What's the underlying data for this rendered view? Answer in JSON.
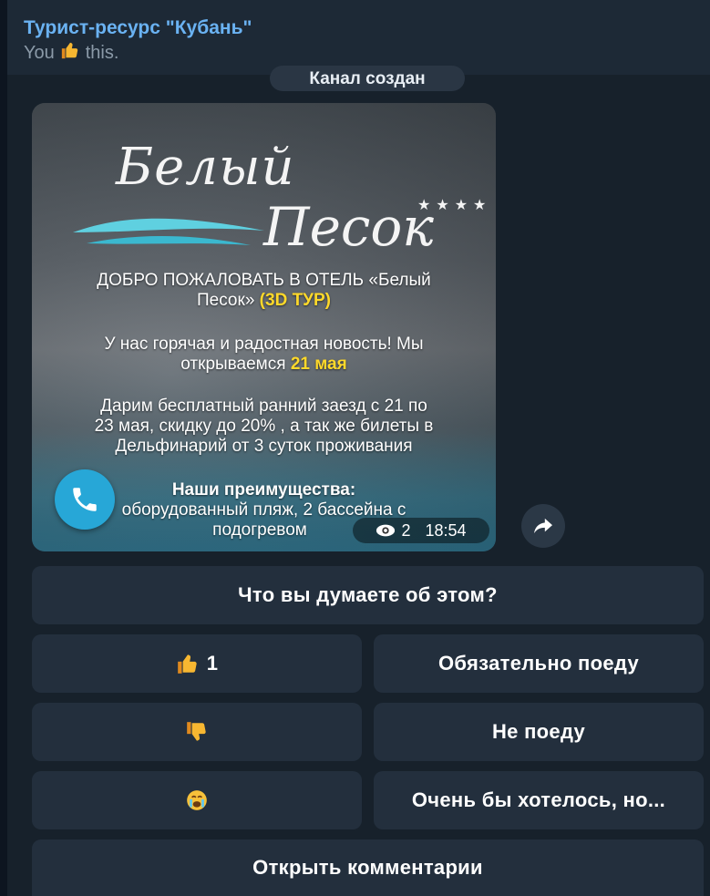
{
  "header": {
    "channel_title": "Турист-ресурс \"Кубань\"",
    "status_you": "You",
    "status_reaction_icon": "thumbs-up-icon",
    "status_suffix": "this."
  },
  "service_message": "Канал создан",
  "post": {
    "logo_word1": "Белый",
    "logo_word2": "Песок",
    "logo_stars": "★★★★",
    "line1": "ДОБРО ПОЖАЛОВАТЬ В ОТЕЛЬ «Белый",
    "line2_plain": "Песок»",
    "line2_bold": "(3D ТУР)",
    "line3": "У нас горячая и радостная новость! Мы",
    "line4_plain": "открываемся",
    "line4_bold": "21 мая",
    "line5": "Дарим бесплатный ранний заезд с 21 по",
    "line6": "23 мая, скидку до 20% , а так же билеты в",
    "line7": "Дельфинарий от 3 суток проживания",
    "line8": "Наши преимущества:",
    "line9": "оборудованный пляж, 2 бассейна с",
    "line10": "подогревом",
    "views": "2",
    "time": "18:54",
    "colors": {
      "highlight": "#ffd92a",
      "call_button": "#27a7d7"
    }
  },
  "keyboard": {
    "question": "Что вы думаете об этом?",
    "like_count": "1",
    "option_go": "Обязательно поеду",
    "option_not_go": "Не поеду",
    "option_wish": "Очень бы хотелось, но...",
    "comments": "Открыть комментарии",
    "icons": [
      "thumbs-up-icon",
      "thumbs-down-icon",
      "crying-face-icon"
    ]
  },
  "colors": {
    "background": "#17212b",
    "accent": "#6ab2f2",
    "button": "#232f3d"
  }
}
